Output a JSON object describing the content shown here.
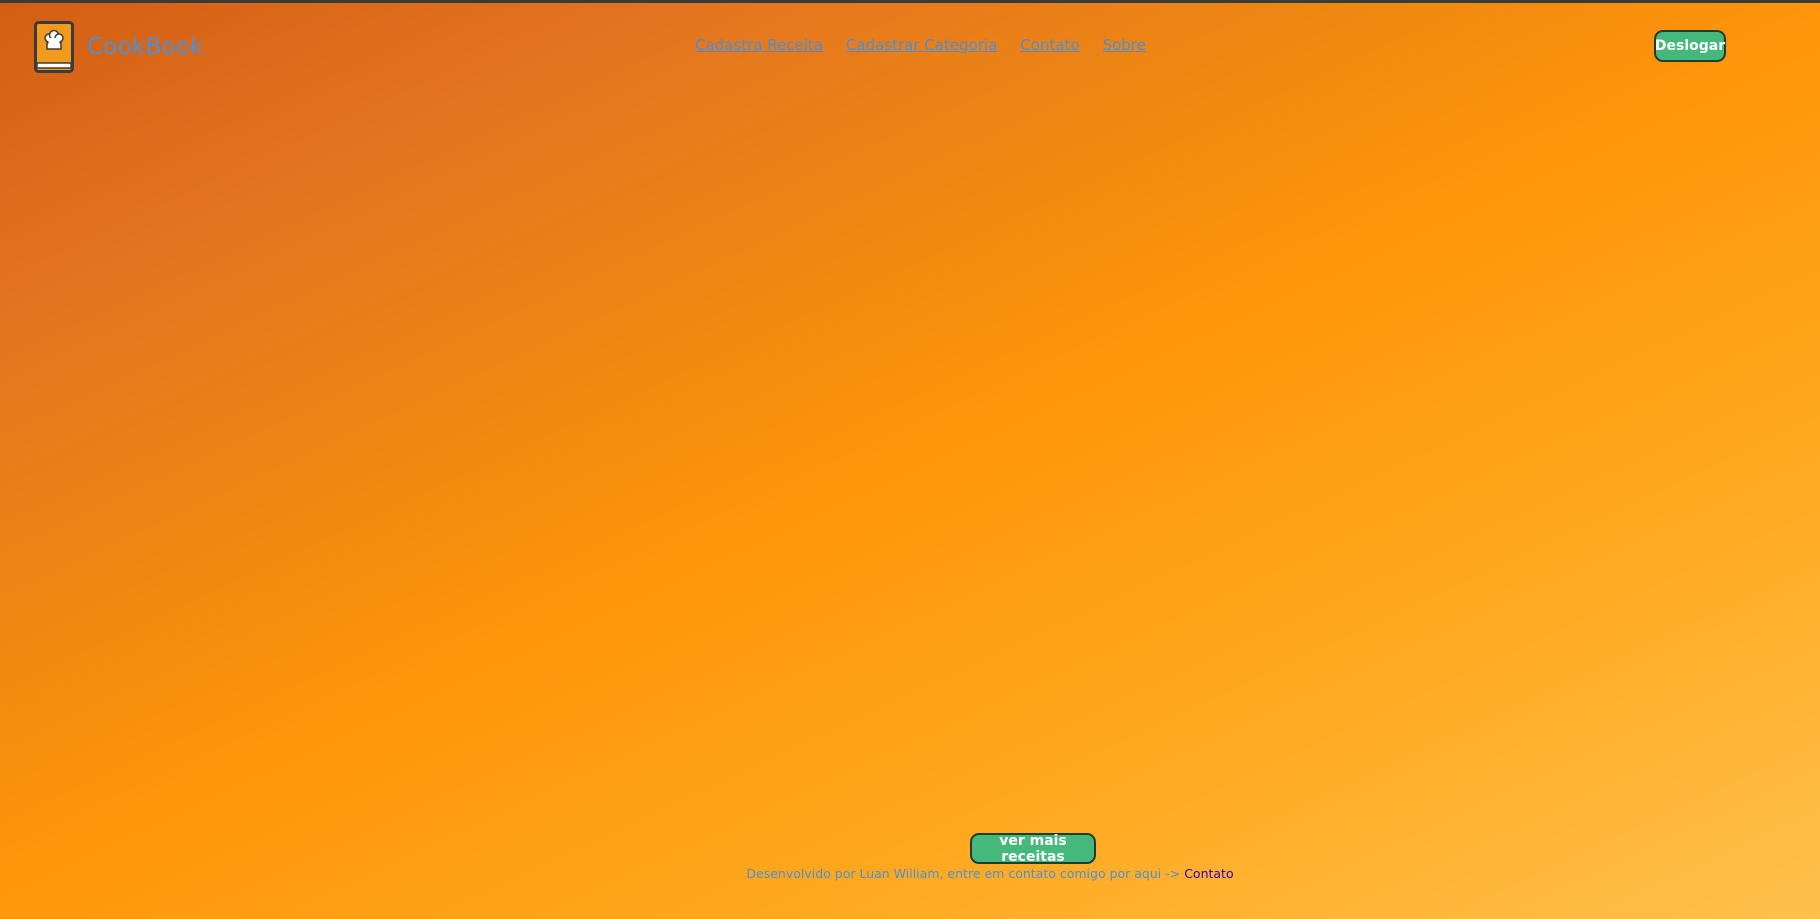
{
  "brand": {
    "name": "CookBook",
    "icon": "chef-hat-book-icon"
  },
  "nav": {
    "items": [
      {
        "label": "Cadastra Receita"
      },
      {
        "label": "Cadastrar Categoria"
      },
      {
        "label": "Contato"
      },
      {
        "label": "Sobre"
      }
    ]
  },
  "header": {
    "logout_label": "Deslogar"
  },
  "main": {
    "more_recipes_label": "ver mais receitas"
  },
  "footer": {
    "text": "Desenvolvido por Luan William, entre em contato comigo por aqui -> ",
    "link_label": "Contato"
  },
  "colors": {
    "button_bg": "#45b87b",
    "link": "#4a90d6",
    "footer_link": "#2d00b8",
    "gradient_start": "#d35e12",
    "gradient_end": "#ffc04c"
  }
}
